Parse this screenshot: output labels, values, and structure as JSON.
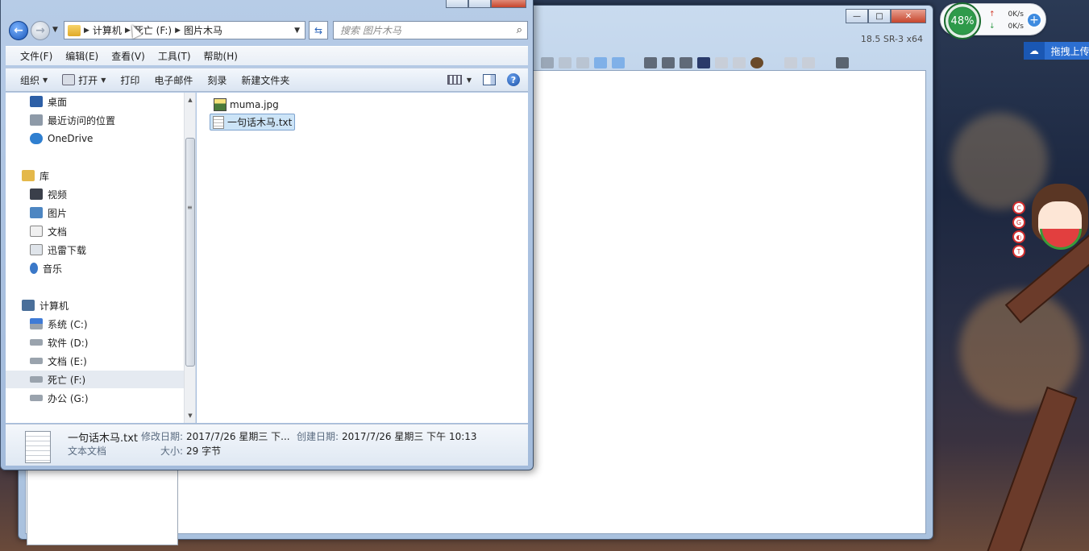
{
  "desktop": {
    "net_monitor": {
      "percent": "48%",
      "up_speed": "0K/s",
      "down_speed": "0K/s"
    },
    "baidu_button": "拖拽上传",
    "colors": {
      "gauge": "#2e9a4a",
      "accent": "#2c6fd1"
    }
  },
  "bg_window": {
    "version": "18.5 SR-3 x64"
  },
  "explorer": {
    "address": {
      "crumbs": [
        "计算机",
        "死亡 (F:)",
        "图片木马"
      ]
    },
    "search_placeholder": "搜索 图片木马",
    "menu": [
      "文件(F)",
      "编辑(E)",
      "查看(V)",
      "工具(T)",
      "帮助(H)"
    ],
    "commands": [
      "组织",
      "打开",
      "打印",
      "电子邮件",
      "刻录",
      "新建文件夹"
    ],
    "nav": {
      "favorites": [
        "桌面",
        "最近访问的位置",
        "OneDrive"
      ],
      "library_header": "库",
      "library": [
        "视频",
        "图片",
        "文档",
        "迅雷下载",
        "音乐"
      ],
      "computer_header": "计算机",
      "drives": [
        "系统 (C:)",
        "软件 (D:)",
        "文档 (E:)",
        "死亡 (F:)",
        "办公 (G:)"
      ]
    },
    "files": [
      {
        "name": "muma.jpg",
        "icon": "jpg-file-icon"
      },
      {
        "name": "一句话木马.txt",
        "icon": "text-file-icon",
        "selected": true
      }
    ],
    "details": {
      "name": "一句话木马.txt",
      "type": "文本文档",
      "modified_label": "修改日期:",
      "modified_value": "2017/7/26 星期三 下...",
      "created_label": "创建日期:",
      "created_value": "2017/7/26 星期三 下午 10:13",
      "size_label": "大小:",
      "size_value": "29 字节"
    }
  }
}
